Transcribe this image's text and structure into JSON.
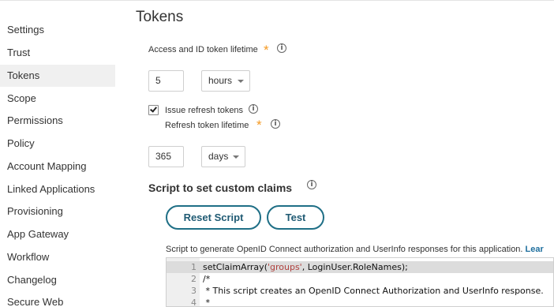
{
  "page": {
    "title": "Tokens"
  },
  "sidebar": {
    "items": [
      {
        "label": "Settings"
      },
      {
        "label": "Trust"
      },
      {
        "label": "Tokens",
        "active": true
      },
      {
        "label": "Scope"
      },
      {
        "label": "Permissions"
      },
      {
        "label": "Policy"
      },
      {
        "label": "Account Mapping"
      },
      {
        "label": "Linked Applications"
      },
      {
        "label": "Provisioning"
      },
      {
        "label": "App Gateway"
      },
      {
        "label": "Workflow"
      },
      {
        "label": "Changelog"
      },
      {
        "label": "Secure Web"
      }
    ]
  },
  "access_token": {
    "label": "Access and ID token lifetime",
    "required_mark": "*",
    "value": "5",
    "unit": "hours"
  },
  "refresh": {
    "checkbox_label": "Issue refresh tokens",
    "checked": true,
    "lifetime_label": "Refresh token lifetime",
    "required_mark": "*",
    "value": "365",
    "unit": "days"
  },
  "script": {
    "section_title": "Script to set custom claims",
    "reset_label": "Reset Script",
    "test_label": "Test",
    "description": "Script to generate OpenID Connect authorization and UserInfo responses for this application.",
    "description_link": "Lear",
    "lines": [
      {
        "num": "1",
        "pre": "setClaimArray(",
        "str": "'groups'",
        "post": ", LoginUser.RoleNames);",
        "highlight": true
      },
      {
        "num": "2",
        "comment": "/*"
      },
      {
        "num": "3",
        "comment": " * This script creates an OpenID Connect Authorization and UserInfo response."
      },
      {
        "num": "4",
        "comment": " *"
      }
    ]
  },
  "icons": {
    "info": "info-circle-icon",
    "dropdown": "chevron-down-icon",
    "check": "check-icon"
  },
  "colors": {
    "required": "#f59a23",
    "button_border": "#1f6f86",
    "link": "#1f6f9e",
    "sidebar_active_bg": "#f0f0f0"
  }
}
